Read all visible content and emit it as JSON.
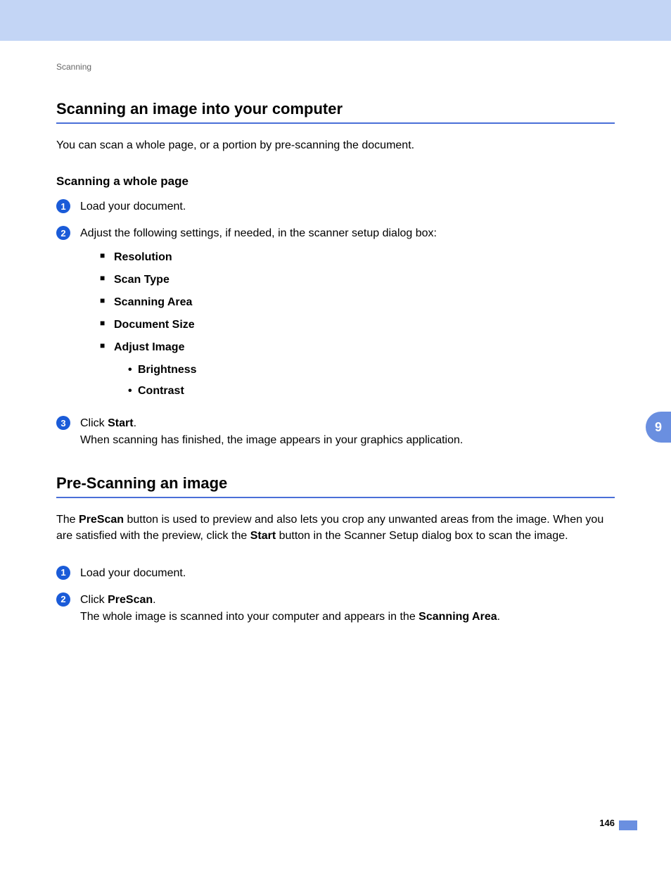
{
  "breadcrumb": "Scanning",
  "section1": {
    "title": "Scanning an image into your computer",
    "intro": "You can scan a whole page, or a portion by pre-scanning the document.",
    "subsection_title": "Scanning a whole page",
    "step1": "Load your document.",
    "step2": "Adjust the following settings, if needed, in the scanner setup dialog box:",
    "settings": {
      "s1": "Resolution",
      "s2": "Scan Type",
      "s3": "Scanning Area",
      "s4": "Document Size",
      "s5": "Adjust Image",
      "sub1": "Brightness",
      "sub2": "Contrast"
    },
    "step3_a": "Click ",
    "step3_b": "Start",
    "step3_c": ".",
    "step3_line2": "When scanning has finished, the image appears in your graphics application."
  },
  "section2": {
    "title": "Pre-Scanning an image",
    "intro_a": "The ",
    "intro_b": "PreScan",
    "intro_c": " button is used to preview and also lets you crop any unwanted areas from the image. When you are satisfied with the preview, click the ",
    "intro_d": "Start",
    "intro_e": " button in the Scanner Setup dialog box to scan the image.",
    "step1": "Load your document.",
    "step2_a": "Click ",
    "step2_b": "PreScan",
    "step2_c": ".",
    "step2_line2_a": "The whole image is scanned into your computer and appears in the ",
    "step2_line2_b": "Scanning Area",
    "step2_line2_c": "."
  },
  "side_tab": "9",
  "page_number": "146",
  "nums": {
    "n1": "1",
    "n2": "2",
    "n3": "3"
  }
}
